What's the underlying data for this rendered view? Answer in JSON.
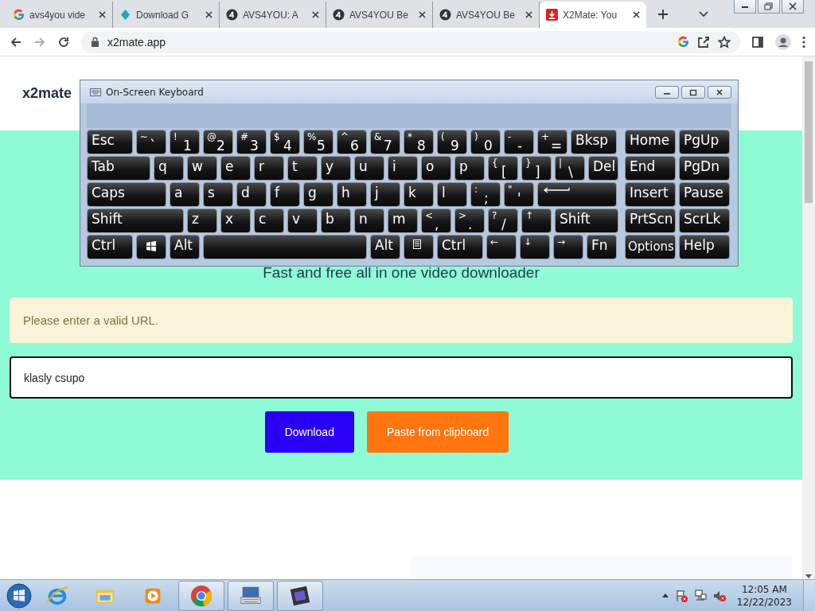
{
  "browser": {
    "tabs": [
      {
        "title": "avs4you vide",
        "selected": false
      },
      {
        "title": "Download G",
        "selected": false
      },
      {
        "title": "AVS4YOU: A",
        "selected": false
      },
      {
        "title": "AVS4YOU Be",
        "selected": false
      },
      {
        "title": "AVS4YOU Be",
        "selected": false
      },
      {
        "title": "X2Mate: You",
        "selected": true
      }
    ],
    "address": "x2mate.app"
  },
  "page": {
    "logo": "x2mate",
    "tagline": "Fast and free all in one video downloader",
    "alert": "Please enter a valid URL.",
    "input": {
      "value": "klasly csupo"
    },
    "buttons": [
      {
        "label": "Download",
        "kind": "primary"
      },
      {
        "label": "Paste from clipboard",
        "kind": "secondary"
      }
    ]
  },
  "keyboard": {
    "title": "On-Screen Keyboard",
    "main_rows": [
      [
        {
          "label": "Esc"
        },
        {
          "top": "~",
          "label": "`"
        },
        {
          "top": "!",
          "label": "1"
        },
        {
          "top": "@",
          "label": "2"
        },
        {
          "top": "#",
          "label": "3"
        },
        {
          "top": "$",
          "label": "4"
        },
        {
          "top": "%",
          "label": "5"
        },
        {
          "top": "^",
          "label": "6"
        },
        {
          "top": "&",
          "label": "7"
        },
        {
          "top": "*",
          "label": "8"
        },
        {
          "top": "(",
          "label": "9"
        },
        {
          "top": ")",
          "label": "0"
        },
        {
          "top": "-",
          "label": "-"
        },
        {
          "top": "+",
          "label": "="
        },
        {
          "label": "Bksp"
        }
      ],
      [
        {
          "label": "Tab"
        },
        {
          "label": "q"
        },
        {
          "label": "w"
        },
        {
          "label": "e"
        },
        {
          "label": "r"
        },
        {
          "label": "t"
        },
        {
          "label": "y"
        },
        {
          "label": "u"
        },
        {
          "label": "i"
        },
        {
          "label": "o"
        },
        {
          "label": "p"
        },
        {
          "top": "{",
          "label": "["
        },
        {
          "top": "}",
          "label": "]"
        },
        {
          "top": "|",
          "label": "\\"
        },
        {
          "label": "Del"
        }
      ],
      [
        {
          "label": "Caps"
        },
        {
          "label": "a"
        },
        {
          "label": "s"
        },
        {
          "label": "d"
        },
        {
          "label": "f"
        },
        {
          "label": "g"
        },
        {
          "label": "h"
        },
        {
          "label": "j"
        },
        {
          "label": "k"
        },
        {
          "label": "l"
        },
        {
          "top": ":",
          "label": ";"
        },
        {
          "top": "\"",
          "label": "'"
        },
        {
          "kind": "enter"
        }
      ],
      [
        {
          "label": "Shift"
        },
        {
          "label": "z"
        },
        {
          "label": "x"
        },
        {
          "label": "c"
        },
        {
          "label": "v"
        },
        {
          "label": "b"
        },
        {
          "label": "n"
        },
        {
          "label": "m"
        },
        {
          "top": "<",
          "label": ","
        },
        {
          "top": ">",
          "label": "."
        },
        {
          "top": "?",
          "label": "/"
        },
        {
          "top": "↑"
        },
        {
          "label": "Shift"
        }
      ],
      [
        {
          "label": "Ctrl"
        },
        {
          "kind": "windows"
        },
        {
          "label": "Alt"
        },
        {
          "kind": "space"
        },
        {
          "label": "Alt"
        },
        {
          "kind": "menu"
        },
        {
          "label": "Ctrl"
        },
        {
          "top": "←"
        },
        {
          "top": "↓"
        },
        {
          "top": "→"
        },
        {
          "label": "Fn"
        }
      ]
    ],
    "nav_rows": [
      [
        {
          "label": "Home"
        },
        {
          "label": "PgUp"
        }
      ],
      [
        {
          "label": "End"
        },
        {
          "label": "PgDn"
        }
      ],
      [
        {
          "label": "Insert"
        },
        {
          "label": "Pause"
        }
      ],
      [
        {
          "label": "PrtScn"
        },
        {
          "label": "ScrLk"
        }
      ],
      [
        {
          "label": "Options",
          "kind": "small"
        },
        {
          "label": "Help"
        }
      ]
    ]
  },
  "taskbar": {
    "apps": [
      {
        "active": false
      },
      {
        "active": false
      },
      {
        "active": false
      },
      {
        "active": true
      },
      {
        "active": true
      },
      {
        "active": true
      }
    ],
    "time": "12:05 AM",
    "date": "12/22/2023"
  }
}
